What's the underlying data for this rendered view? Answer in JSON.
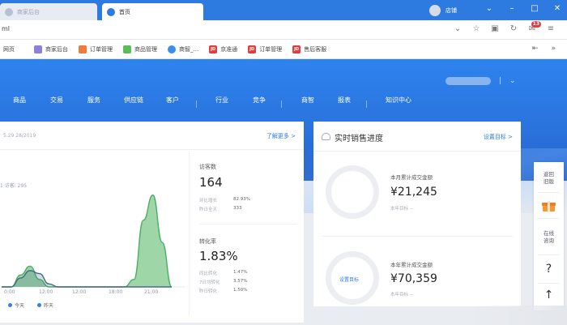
{
  "browser": {
    "tabs": [
      {
        "label": "商家后台",
        "active": false
      },
      {
        "label": "首页",
        "active": true
      }
    ],
    "user_label": "店铺",
    "window_controls": [
      "chevron-down",
      "minimize",
      "maximize",
      "close"
    ],
    "url": "ml",
    "notification_count": "13",
    "bookmarks": [
      {
        "label": "网页",
        "icon": "none"
      },
      {
        "label": "商家后台",
        "icon": "purple"
      },
      {
        "label": "订单管理",
        "icon": "orange"
      },
      {
        "label": "商品管理",
        "icon": "green"
      },
      {
        "label": "商智_...",
        "icon": "globe"
      },
      {
        "label": "京准通",
        "icon": "jd"
      },
      {
        "label": "订单管理",
        "icon": "jd"
      },
      {
        "label": "售后客服",
        "icon": "jd"
      }
    ]
  },
  "nav": {
    "items": [
      "商品",
      "交易",
      "服务",
      "供应链",
      "客户",
      "行业",
      "竞争",
      "商智",
      "报表",
      "知识中心"
    ]
  },
  "traffic_card": {
    "date_range": "5.29 28/2019",
    "more_link": "了解更多 >",
    "visitors_note": "1 访客: 295",
    "x_ticks": [
      "0:00",
      "12:00",
      "12:00",
      "18:00",
      "21:00"
    ],
    "legend": [
      {
        "label": "今天",
        "color": "#3a7fd8"
      },
      {
        "label": "昨天",
        "color": "#3a7fd8"
      }
    ],
    "visitors": {
      "label": "访客数",
      "value": "164",
      "sub": [
        {
          "label": "环比增长",
          "value": "82.93%"
        },
        {
          "label": "昨日全天",
          "value": "333"
        }
      ]
    },
    "conversion": {
      "label": "转化率",
      "value": "1.83%",
      "sub": [
        {
          "label": "同比转化",
          "value": "1.47%"
        },
        {
          "label": "7日均转化",
          "value": "3.57%"
        },
        {
          "label": "昨日转化",
          "value": "1.50%"
        }
      ]
    }
  },
  "sales_card": {
    "title": "实时销售进度",
    "link": "设置目标 >",
    "month": {
      "label": "本月累计成交金额",
      "value": "¥21,245",
      "compare": "本年目标 --"
    },
    "year": {
      "label": "本年累计成交金额",
      "value": "¥70,359",
      "compare": "本年目标 --",
      "ring_text": "设置目标"
    }
  },
  "side_panel": {
    "top_label_1": "返回",
    "top_label_2": "旧版",
    "gift_label_1": "在线",
    "gift_label_2": "咨询",
    "help_glyph": "?",
    "top_glyph": "↑"
  },
  "chart_data": {
    "type": "area",
    "x_ticks": [
      "0:00",
      "12:00",
      "12:00",
      "18:00",
      "21:00"
    ],
    "series": [
      {
        "name": "今天",
        "points": [
          [
            0,
            0
          ],
          [
            1,
            0
          ],
          [
            2,
            8
          ],
          [
            3,
            14
          ],
          [
            4,
            5
          ],
          [
            5,
            0
          ],
          [
            6,
            0
          ],
          [
            7,
            0
          ],
          [
            8,
            0
          ],
          [
            9,
            0
          ],
          [
            10,
            0
          ],
          [
            11,
            0
          ],
          [
            12,
            0
          ],
          [
            13,
            0
          ],
          [
            14,
            5
          ],
          [
            15,
            45
          ],
          [
            16,
            62
          ],
          [
            17,
            30
          ],
          [
            18,
            0
          ]
        ]
      },
      {
        "name": "昨天",
        "points": [
          [
            0,
            0
          ],
          [
            1,
            0
          ],
          [
            2,
            6
          ],
          [
            3,
            11
          ],
          [
            4,
            9
          ],
          [
            5,
            2
          ],
          [
            6,
            0
          ],
          [
            7,
            0
          ],
          [
            8,
            0
          ],
          [
            9,
            0
          ],
          [
            10,
            0
          ],
          [
            11,
            0
          ],
          [
            12,
            0
          ],
          [
            13,
            0
          ],
          [
            14,
            0
          ],
          [
            15,
            0
          ],
          [
            16,
            0
          ],
          [
            17,
            0
          ],
          [
            18,
            0
          ]
        ]
      }
    ],
    "colors": {
      "today_fill": "#9ed6a8",
      "today_line": "#4caf62",
      "yesterday_line": "#486b85"
    }
  }
}
